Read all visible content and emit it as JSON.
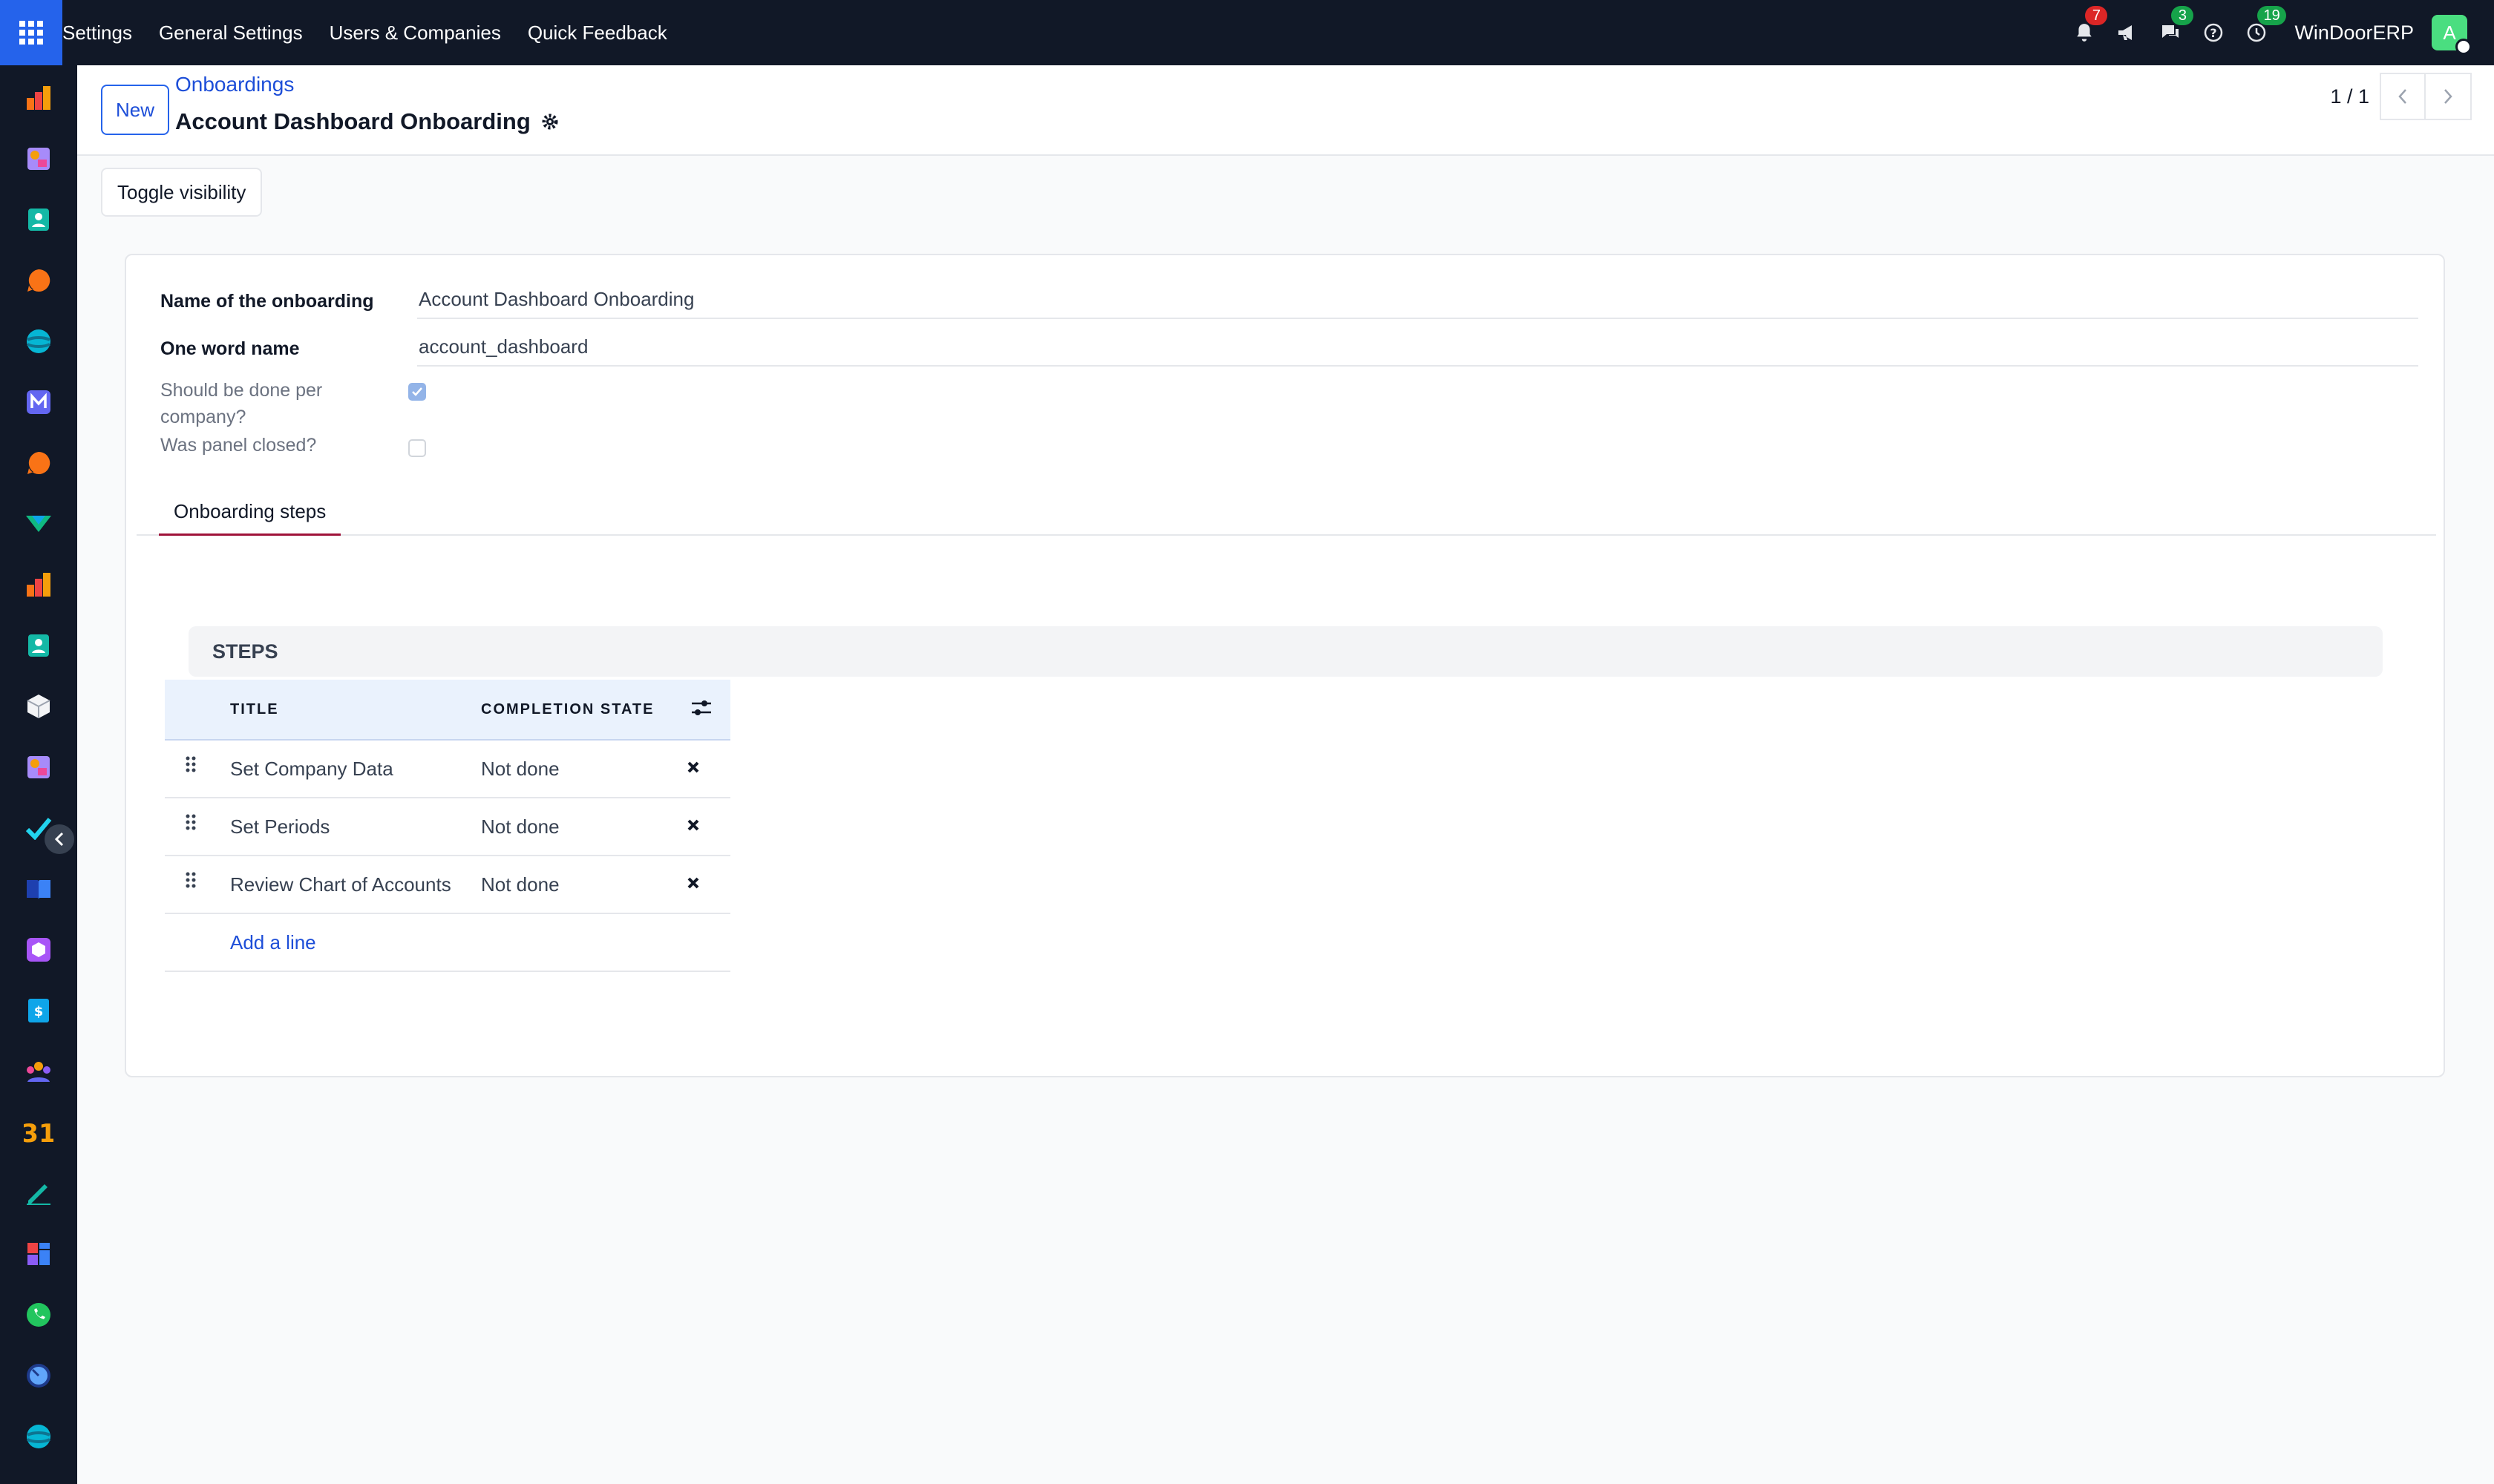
{
  "navbar": {
    "menu": [
      "Settings",
      "General Settings",
      "Users & Companies",
      "Quick Feedback"
    ],
    "badges": {
      "notifications": "7",
      "messages": "3",
      "activities": "19"
    },
    "company": "WinDoorERP",
    "avatar_letter": "A"
  },
  "control": {
    "new_label": "New",
    "breadcrumb": "Onboardings",
    "title": "Account Dashboard Onboarding",
    "pager": "1 / 1"
  },
  "status": {
    "toggle_label": "Toggle visibility"
  },
  "form": {
    "name_label": "Name of the onboarding",
    "name_value": "Account Dashboard Onboarding",
    "word_label": "One word name",
    "word_value": "account_dashboard",
    "per_company_label": "Should be done per company?",
    "per_company_checked": true,
    "panel_closed_label": "Was panel closed?",
    "panel_closed_checked": false,
    "tab_label": "Onboarding steps",
    "steps_title": "STEPS",
    "columns": [
      "TITLE",
      "COMPLETION STATE"
    ],
    "rows": [
      {
        "title": "Set Company Data",
        "state": "Not done"
      },
      {
        "title": "Set Periods",
        "state": "Not done"
      },
      {
        "title": "Review Chart of Accounts",
        "state": "Not done"
      }
    ],
    "add_line": "Add a line"
  },
  "colors": {
    "navbar": "#111827",
    "accent": "#2563eb",
    "tab_underline": "#9f1239"
  }
}
